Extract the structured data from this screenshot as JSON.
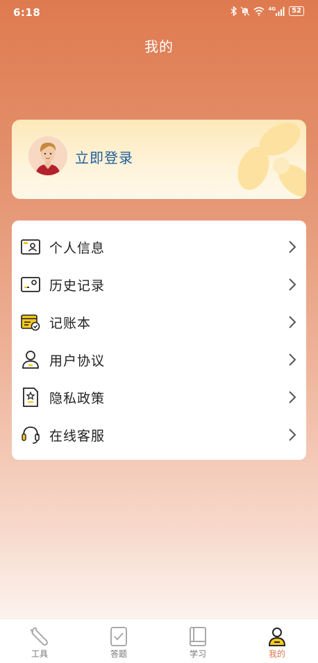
{
  "status_bar": {
    "time": "6:18",
    "network": "4G",
    "battery": "52",
    "icons": [
      "bluetooth-icon",
      "mute-icon",
      "wifi-icon",
      "signal-icon",
      "battery-icon"
    ]
  },
  "header": {
    "title": "我的"
  },
  "login": {
    "label": "立即登录",
    "avatar": "avatar-icon"
  },
  "menu": {
    "items": [
      {
        "label": "个人信息",
        "icon": "id-card-icon"
      },
      {
        "label": "历史记录",
        "icon": "history-card-icon"
      },
      {
        "label": "记账本",
        "icon": "ledger-icon"
      },
      {
        "label": "用户协议",
        "icon": "user-icon"
      },
      {
        "label": "隐私政策",
        "icon": "privacy-document-icon"
      },
      {
        "label": "在线客服",
        "icon": "headset-icon"
      }
    ]
  },
  "tabbar": {
    "active_color": "#d9774c",
    "items": [
      {
        "label": "工具",
        "icon": "wrench-icon"
      },
      {
        "label": "答题",
        "icon": "checkbox-icon"
      },
      {
        "label": "学习",
        "icon": "book-icon"
      },
      {
        "label": "我的",
        "icon": "profile-icon",
        "active": true
      }
    ]
  },
  "colors": {
    "header_gradient_top": "#df7a4f",
    "accent_yellow": "#f6c81e",
    "login_text": "#1d5d9b"
  }
}
